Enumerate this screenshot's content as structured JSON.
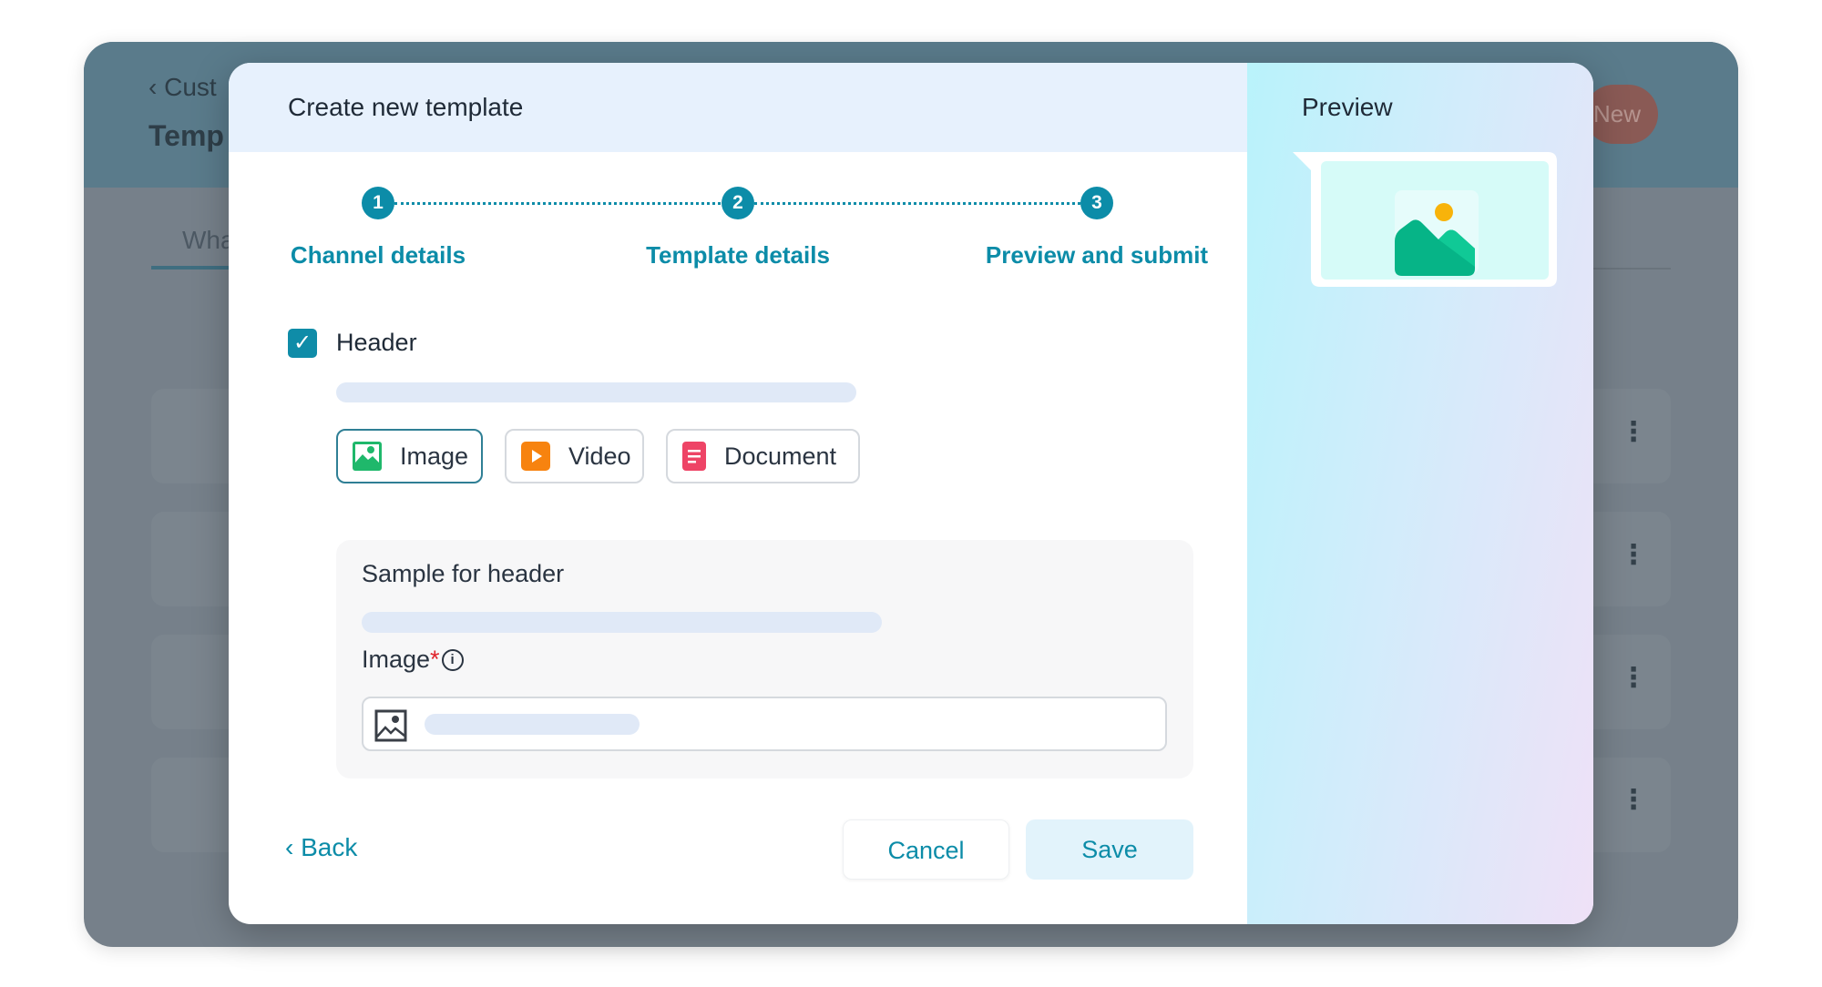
{
  "background": {
    "back_link": "Cust",
    "page_title": "Temp",
    "tab": "Wha",
    "new_button": "New"
  },
  "modal": {
    "title": "Create new template",
    "steps": [
      {
        "number": "1",
        "label": "Channel details"
      },
      {
        "number": "2",
        "label": "Template details"
      },
      {
        "number": "3",
        "label": "Preview and submit"
      }
    ],
    "header_checkbox": {
      "label": "Header",
      "checked": true
    },
    "media_types": [
      {
        "label": "Image",
        "icon": "image-icon",
        "selected": true,
        "color": "#1fb86b"
      },
      {
        "label": "Video",
        "icon": "video-icon",
        "selected": false,
        "color": "#f7830f"
      },
      {
        "label": "Document",
        "icon": "document-icon",
        "selected": false,
        "color": "#ee4466"
      }
    ],
    "sample": {
      "title": "Sample for header",
      "field_label": "Image",
      "required_mark": "*"
    },
    "back_label": "Back",
    "cancel_label": "Cancel",
    "save_label": "Save"
  },
  "preview": {
    "title": "Preview"
  },
  "colors": {
    "accent": "#0c8ca8",
    "required": "#e0242c"
  }
}
